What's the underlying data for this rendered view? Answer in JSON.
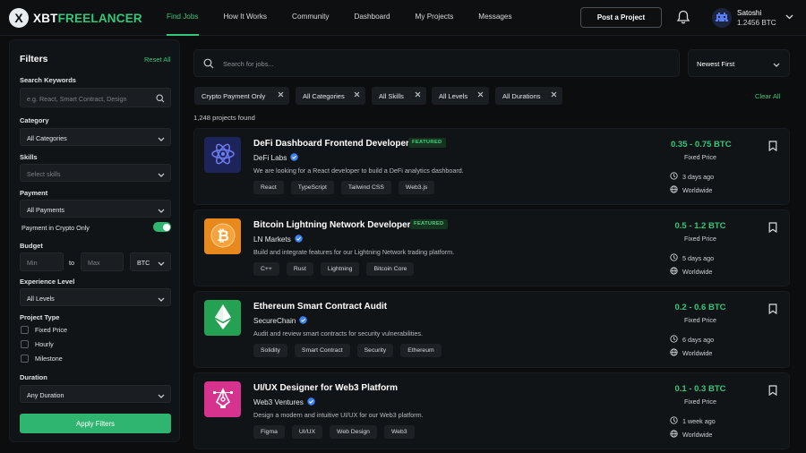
{
  "brand": {
    "logo_letter": "X",
    "name_prefix": "XBT",
    "name_suffix": "FREELANCER"
  },
  "nav": {
    "links": [
      "Find Jobs",
      "How It Works",
      "Community",
      "Dashboard",
      "My Projects",
      "Messages"
    ],
    "active_index": 0,
    "post_button": "Post a Project",
    "user": {
      "name": "Satoshi",
      "balance": "1.2456 BTC"
    }
  },
  "filters": {
    "title": "Filters",
    "reset": "Reset All",
    "search": {
      "label": "Search Keywords",
      "placeholder": "e.g. React, Smart Contract, Design"
    },
    "category": {
      "label": "Category",
      "value": "All Categories"
    },
    "skills": {
      "label": "Skills",
      "value": "Select skills"
    },
    "payment": {
      "label": "Payment",
      "value": "All Payments"
    },
    "crypto_only": {
      "label": "Payment in Crypto Only",
      "enabled": true
    },
    "budget": {
      "label": "Budget",
      "min_placeholder": "Min",
      "to": "to",
      "max_placeholder": "Max",
      "currency": "BTC"
    },
    "experience": {
      "label": "Experience Level",
      "value": "All Levels"
    },
    "project_type": {
      "label": "Project Type",
      "options": [
        "Fixed Price",
        "Hourly",
        "Milestone"
      ]
    },
    "duration": {
      "label": "Duration",
      "value": "Any Duration"
    },
    "apply": "Apply Filters"
  },
  "main": {
    "search_placeholder": "Search for jobs...",
    "sort": "Newest First",
    "chips": [
      "Crypto Payment Only",
      "All Categories",
      "All Skills",
      "All Levels",
      "All Durations"
    ],
    "clear_all": "Clear All",
    "count": "1,248 projects found"
  },
  "jobs": [
    {
      "title": "DeFi Dashboard Frontend Developer",
      "featured": "FEATURED",
      "company": "DeFi Labs",
      "desc": "We are looking for a React developer to build a DeFi analytics dashboard.",
      "tags": [
        "React",
        "TypeScript",
        "Tailwind CSS",
        "Web3.js"
      ],
      "price": "0.35 - 0.75 BTC",
      "price_type": "Fixed Price",
      "posted": "3 days ago",
      "location": "Worldwide",
      "icon": "atom-icon",
      "icon_bg": "#1d2459"
    },
    {
      "title": "Bitcoin Lightning Network Developer",
      "featured": "FEATURED",
      "company": "LN Markets",
      "desc": "Build and integrate features for our Lightning Network trading platform.",
      "tags": [
        "C++",
        "Rust",
        "Lightning",
        "Bitcoin Core"
      ],
      "price": "0.5 - 1.2 BTC",
      "price_type": "Fixed Price",
      "posted": "5 days ago",
      "location": "Worldwide",
      "icon": "bitcoin-icon",
      "icon_bg": "#e8891d"
    },
    {
      "title": "Ethereum Smart Contract Audit",
      "featured": "",
      "company": "SecureChain",
      "desc": "Audit and review smart contracts for security vulnerabilities.",
      "tags": [
        "Solidity",
        "Smart Contract",
        "Security",
        "Ethereum"
      ],
      "price": "0.2 - 0.6 BTC",
      "price_type": "Fixed Price",
      "posted": "6 days ago",
      "location": "Worldwide",
      "icon": "ethereum-icon",
      "icon_bg": "#24a153"
    },
    {
      "title": "UI/UX Designer for Web3 Platform",
      "featured": "",
      "company": "Web3 Ventures",
      "desc": "Design a modern and intuitive UI/UX for our Web3 platform.",
      "tags": [
        "Figma",
        "UI/UX",
        "Web Design",
        "Web3"
      ],
      "price": "0.1 - 0.3 BTC",
      "price_type": "Fixed Price",
      "posted": "1 week ago",
      "location": "Worldwide",
      "icon": "pen-tool-icon",
      "icon_bg": "#d6338f"
    }
  ]
}
